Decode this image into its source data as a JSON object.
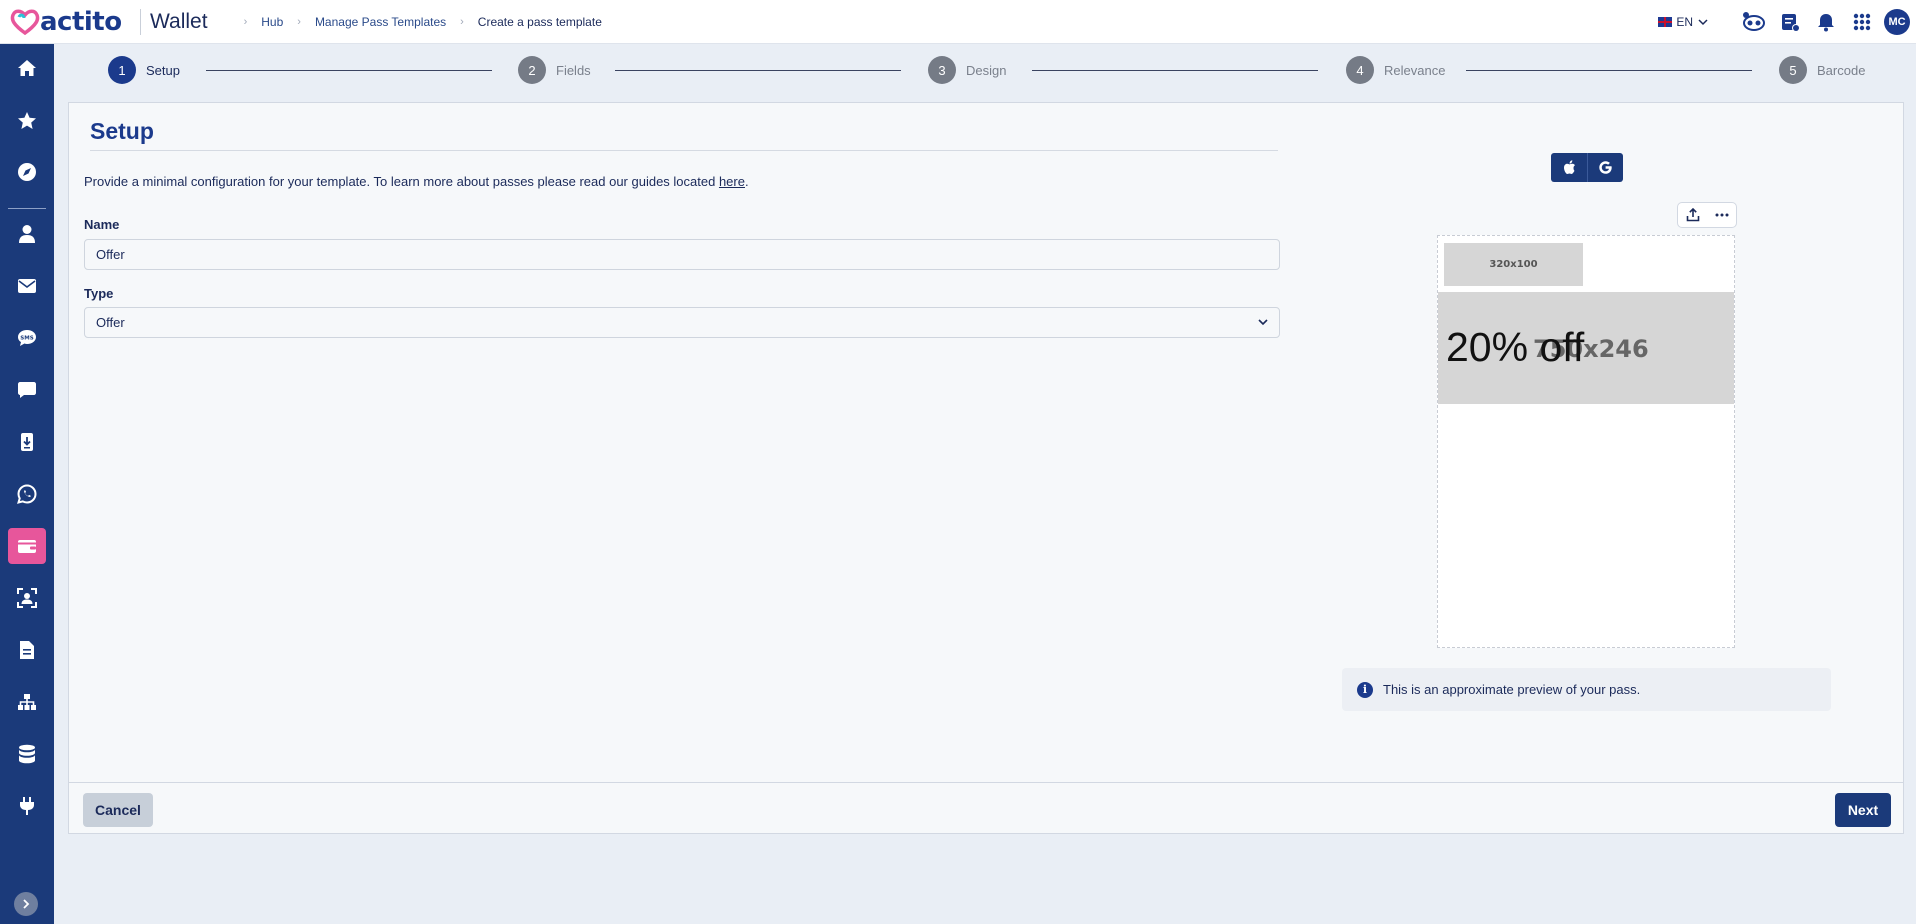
{
  "colors": {
    "brand_navy": "#1b3a8c",
    "sidebar_bg": "#1b3a7a",
    "active_pink": "#e7569b",
    "step_inactive": "#757b86"
  },
  "header": {
    "logo_text": "actito",
    "app_title": "Wallet",
    "breadcrumbs": [
      "Hub",
      "Manage Pass Templates",
      "Create a pass template"
    ],
    "language": "EN",
    "avatar_initials": "MC"
  },
  "sidebar": {
    "items": [
      {
        "icon": "home-icon"
      },
      {
        "icon": "star-icon"
      },
      {
        "icon": "compass-icon"
      },
      {
        "icon": "person-icon"
      },
      {
        "icon": "envelope-icon"
      },
      {
        "icon": "sms-icon",
        "label": "SMS"
      },
      {
        "icon": "chat-icon"
      },
      {
        "icon": "mobile-download-icon"
      },
      {
        "icon": "whatsapp-icon"
      },
      {
        "icon": "wallet-icon",
        "active": true
      },
      {
        "icon": "face-scan-icon"
      },
      {
        "icon": "document-icon"
      },
      {
        "icon": "sitemap-icon"
      },
      {
        "icon": "database-icon"
      },
      {
        "icon": "plug-icon"
      }
    ]
  },
  "stepper": {
    "steps": [
      {
        "number": "1",
        "label": "Setup",
        "active": true
      },
      {
        "number": "2",
        "label": "Fields"
      },
      {
        "number": "3",
        "label": "Design"
      },
      {
        "number": "4",
        "label": "Relevance"
      },
      {
        "number": "5",
        "label": "Barcode"
      }
    ]
  },
  "setup": {
    "title": "Setup",
    "intro_text": "Provide a minimal configuration for your template. To learn more about passes please read our guides located ",
    "intro_link": "here",
    "intro_end": ".",
    "name_label": "Name",
    "name_value": "Offer",
    "type_label": "Type",
    "type_value": "Offer"
  },
  "preview": {
    "logo_placeholder": "320x100",
    "strip_placeholder": "750x246",
    "strip_value": "20% off",
    "notice": "This is an approximate preview of your pass."
  },
  "footer": {
    "cancel_label": "Cancel",
    "next_label": "Next"
  }
}
